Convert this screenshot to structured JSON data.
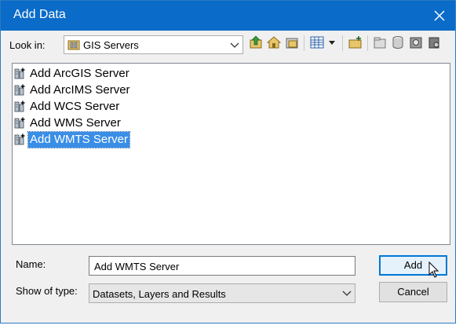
{
  "window": {
    "title": "Add Data"
  },
  "toolbar": {
    "look_in_label": "Look in:",
    "look_in_value": "GIS Servers",
    "icons": [
      "up-one-level-icon",
      "home-icon",
      "connect-to-folder-icon",
      "view-menu-icon",
      "dropdown-arrow-icon",
      "new-folder-icon",
      "catalog-icon",
      "database-icon",
      "geodatabase-icon",
      "server-icon"
    ]
  },
  "list": {
    "items": [
      {
        "label": "Add ArcGIS Server",
        "selected": false
      },
      {
        "label": "Add ArcIMS Server",
        "selected": false
      },
      {
        "label": "Add WCS Server",
        "selected": false
      },
      {
        "label": "Add WMS Server",
        "selected": false
      },
      {
        "label": "Add WMTS Server",
        "selected": true
      }
    ]
  },
  "form": {
    "name_label": "Name:",
    "name_value": "Add WMTS Server",
    "type_label": "Show of type:",
    "type_value": "Datasets, Layers and Results"
  },
  "buttons": {
    "add": "Add",
    "cancel": "Cancel"
  },
  "colors": {
    "titlebar": "#0a6bc8",
    "selection": "#3a8ee6",
    "dialog_bg": "#f0f0f0"
  }
}
